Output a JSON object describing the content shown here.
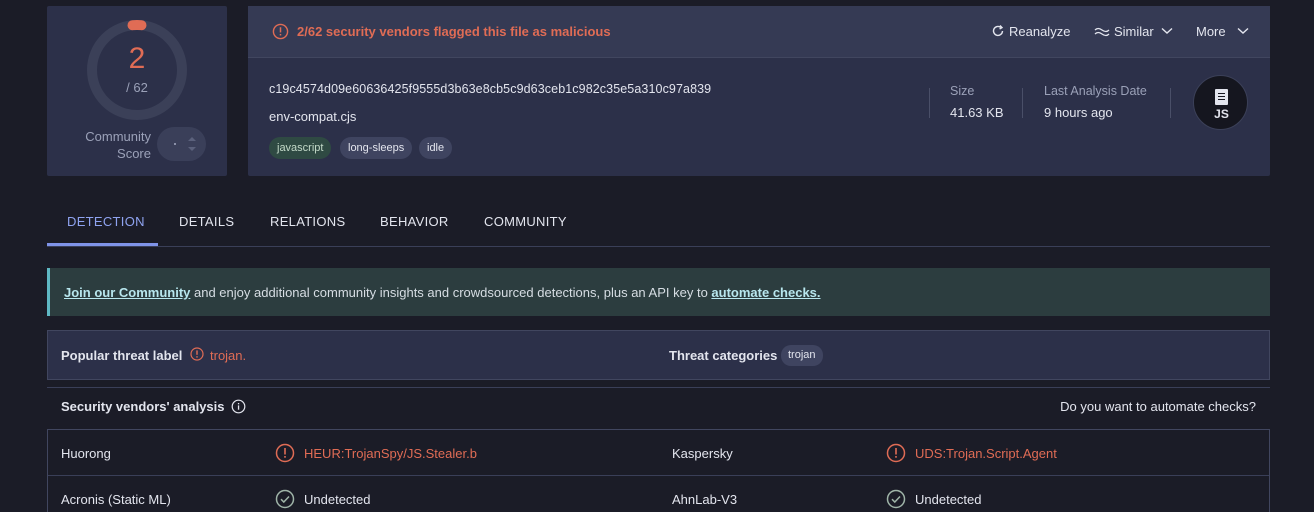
{
  "score": {
    "detections": "2",
    "total": "/ 62",
    "community_label": "Community Score"
  },
  "header": {
    "flag_text": "2/62 security vendors flagged this file as malicious",
    "reanalyze_label": "Reanalyze",
    "similar_label": "Similar",
    "more_label": "More"
  },
  "file": {
    "hash": "c19c4574d09e60636425f9555d3b63e8cb5c9d63ceb1c982c35e5a310c97a839",
    "name": "env-compat.cjs",
    "tags": [
      "javascript",
      "long-sleeps",
      "idle"
    ],
    "size_label": "Size",
    "size_value": "41.63 KB",
    "date_label": "Last Analysis Date",
    "date_value": "9 hours ago",
    "type_badge": "JS"
  },
  "tabs": [
    "DETECTION",
    "DETAILS",
    "RELATIONS",
    "BEHAVIOR",
    "COMMUNITY"
  ],
  "banner": {
    "link1": "Join our Community",
    "middle": " and enjoy additional community insights and crowdsourced detections, plus an API key to ",
    "link2": "automate checks."
  },
  "threat": {
    "popular_label": "Popular threat label",
    "popular_value": "trojan.",
    "categories_label": "Threat categories",
    "category_tag": "trojan"
  },
  "vendors": {
    "title": "Security vendors' analysis",
    "automate_prompt": "Do you want to automate checks?",
    "rows": [
      {
        "left_name": "Huorong",
        "left_result": "HEUR:TrojanSpy/JS.Stealer.b",
        "right_name": "Kaspersky",
        "right_result": "UDS:Trojan.Script.Agent"
      },
      {
        "left_name": "Acronis (Static ML)",
        "left_result": "Undetected",
        "right_name": "AhnLab-V3",
        "right_result": "Undetected"
      }
    ]
  },
  "colors": {
    "malicious": "#e06c55",
    "accent": "#8fa3f0",
    "card": "#2c3049",
    "background": "#1b1c27"
  }
}
